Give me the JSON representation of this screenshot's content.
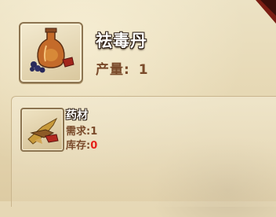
{
  "product": {
    "name": "祛毒丹",
    "yield_label": "产量:",
    "yield_value": "1",
    "icon": "potion-bottle-icon"
  },
  "material": {
    "title": "药材",
    "required_label": "需求:",
    "required_value": "1",
    "stock_label": "库存:",
    "stock_value": "0",
    "icon": "herb-bundle-icon"
  },
  "colors": {
    "stock_insufficient": "#e5221b",
    "label_brown": "#7a4a2a"
  }
}
